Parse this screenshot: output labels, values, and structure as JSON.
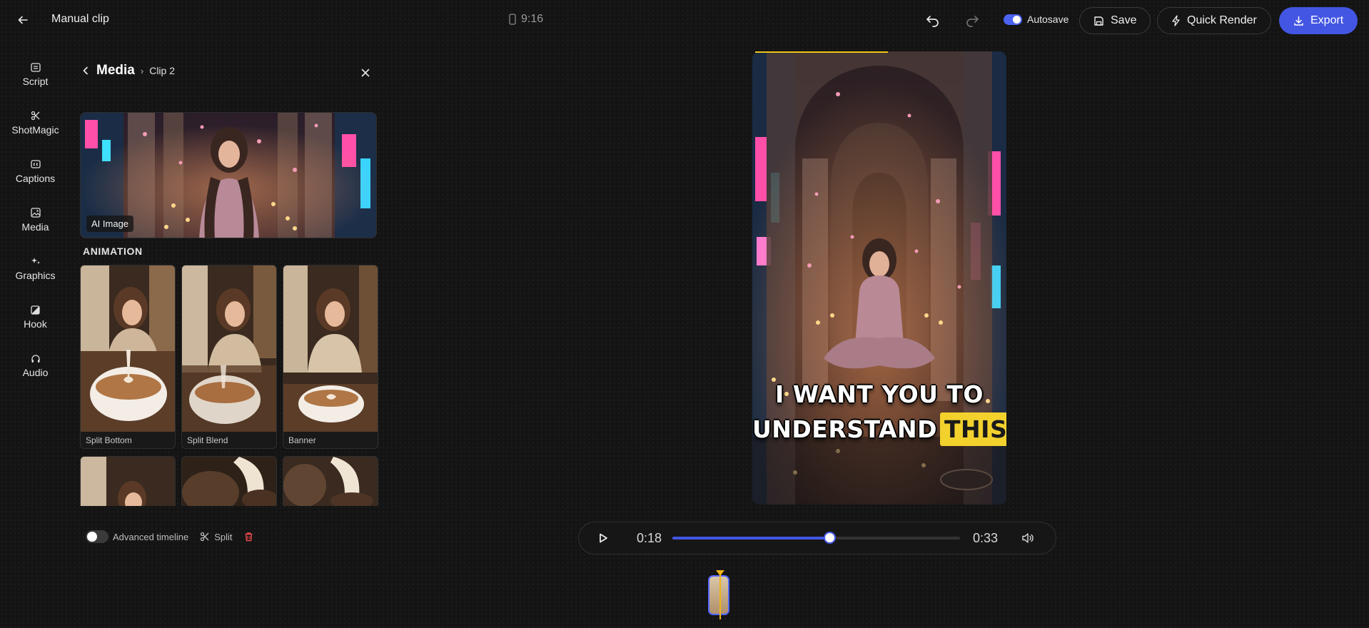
{
  "header": {
    "title": "Manual clip",
    "aspect_ratio": "9:16",
    "autosave_label": "Autosave",
    "autosave_on": true,
    "save_label": "Save",
    "quick_render_label": "Quick Render",
    "export_label": "Export"
  },
  "sidebar": {
    "items": [
      {
        "label": "Script",
        "icon": "script-icon"
      },
      {
        "label": "ShotMagic",
        "icon": "scissors-icon"
      },
      {
        "label": "Captions",
        "icon": "captions-icon"
      },
      {
        "label": "Media",
        "icon": "image-icon"
      },
      {
        "label": "Graphics",
        "icon": "sparkle-icon"
      },
      {
        "label": "Hook",
        "icon": "hook-icon"
      },
      {
        "label": "Audio",
        "icon": "headphones-icon"
      }
    ]
  },
  "panel": {
    "title": "Media",
    "breadcrumb": "Clip 2",
    "hero_badge": "AI Image",
    "section_label": "ANIMATION",
    "animations": [
      {
        "label": "Split Bottom"
      },
      {
        "label": "Split Blend"
      },
      {
        "label": "Banner"
      }
    ],
    "advanced_timeline_label": "Advanced timeline",
    "advanced_timeline_on": false,
    "split_label": "Split"
  },
  "preview": {
    "caption_line1": "I WANT YOU TO",
    "caption_line2_word": "UNDERSTAND",
    "caption_highlight": "THIS",
    "highlight_color": "#f3d12d"
  },
  "player": {
    "current_time": "0:18",
    "total_time": "0:33",
    "progress_fraction": 0.545
  },
  "colors": {
    "accent": "#4356e3",
    "playhead": "#f0b419",
    "delete": "#e5484d"
  }
}
